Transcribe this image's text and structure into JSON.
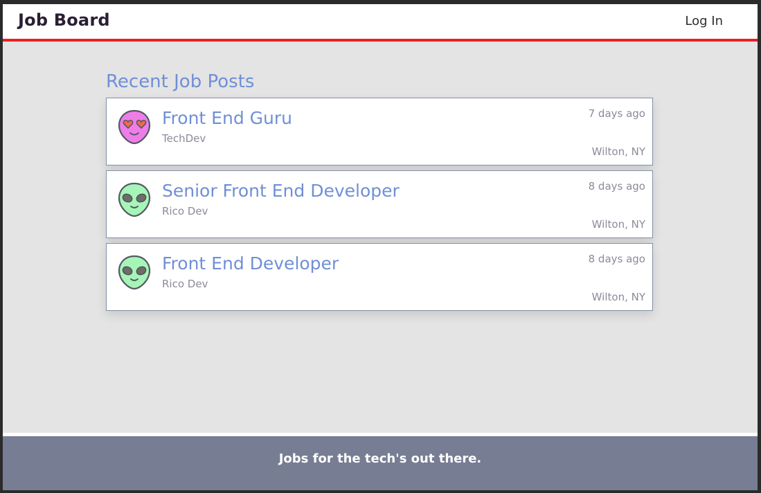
{
  "navbar": {
    "brand": "Job Board",
    "login_label": "Log In",
    "accent_color": "#f01d1d"
  },
  "main": {
    "heading": "Recent Job Posts",
    "jobs": [
      {
        "title": "Front End Guru",
        "company": "TechDev",
        "posted": "7 days ago",
        "location": "Wilton, NY",
        "avatar_icon": "alien-heart-eyes-icon",
        "avatar_color": "#ef7de9"
      },
      {
        "title": "Senior Front End Developer",
        "company": "Rico Dev",
        "posted": "8 days ago",
        "location": "Wilton, NY",
        "avatar_icon": "alien-icon",
        "avatar_color": "#a6f5b8"
      },
      {
        "title": "Front End Developer",
        "company": "Rico Dev",
        "posted": "8 days ago",
        "location": "Wilton, NY",
        "avatar_icon": "alien-icon",
        "avatar_color": "#a6f5b8"
      }
    ]
  },
  "footer": {
    "tagline": "Jobs for the tech's out there."
  }
}
